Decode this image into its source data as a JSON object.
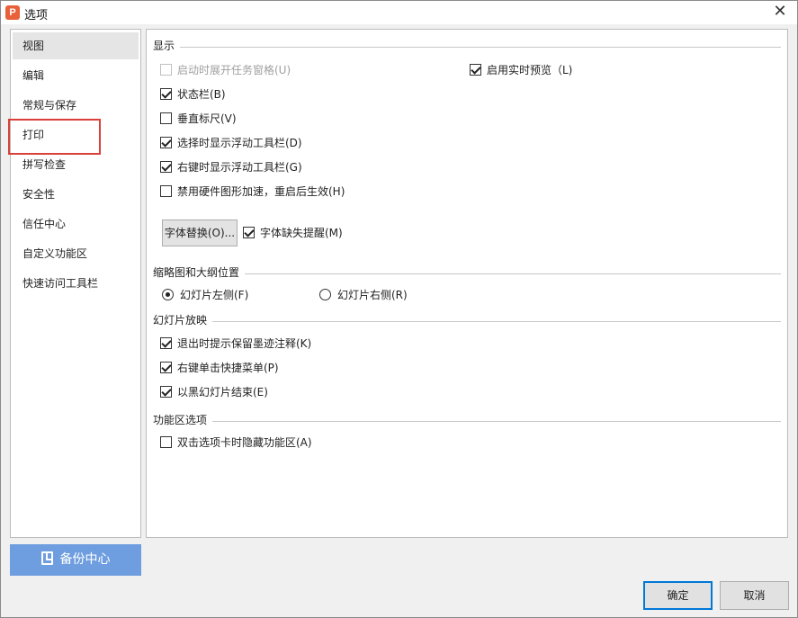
{
  "window": {
    "title": "选项",
    "app_icon_glyph": "P"
  },
  "nav": {
    "items": [
      {
        "label": "视图",
        "active": true
      },
      {
        "label": "编辑"
      },
      {
        "label": "常规与保存"
      },
      {
        "label": "打印"
      },
      {
        "label": "拼写检查"
      },
      {
        "label": "安全性"
      },
      {
        "label": "信任中心"
      },
      {
        "label": "自定义功能区"
      },
      {
        "label": "快速访问工具栏"
      }
    ],
    "backup_label": "备份中心"
  },
  "sections": {
    "display": {
      "title": "显示",
      "show_task_pane": {
        "label": "启动时展开任务窗格(U)",
        "checked": false,
        "disabled": true
      },
      "live_preview": {
        "label": "启用实时预览（L)",
        "checked": true
      },
      "status_bar": {
        "label": "状态栏(B)",
        "checked": true
      },
      "vertical_ruler": {
        "label": "垂直标尺(V)",
        "checked": false
      },
      "float_toolbar_select": {
        "label": "选择时显示浮动工具栏(D)",
        "checked": true
      },
      "float_toolbar_right": {
        "label": "右键时显示浮动工具栏(G)",
        "checked": true
      },
      "disable_hw_accel": {
        "label": "禁用硬件图形加速，重启后生效(H)",
        "checked": false
      },
      "font_replace_button": "字体替换(O)...",
      "missing_font_alert": {
        "label": "字体缺失提醒(M)",
        "checked": true
      }
    },
    "thumbnail": {
      "title": "缩略图和大纲位置",
      "left": {
        "label": "幻灯片左侧(F)",
        "selected": true
      },
      "right": {
        "label": "幻灯片右侧(R)",
        "selected": false
      }
    },
    "slideshow": {
      "title": "幻灯片放映",
      "keep_ink": {
        "label": "退出时提示保留墨迹注释(K)",
        "checked": true
      },
      "right_click_menu": {
        "label": "右键单击快捷菜单(P)",
        "checked": true
      },
      "end_black": {
        "label": "以黑幻灯片结束(E)",
        "checked": true
      }
    },
    "ribbon": {
      "title": "功能区选项",
      "hide_on_dblclick": {
        "label": "双击选项卡时隐藏功能区(A)",
        "checked": false
      }
    }
  },
  "footer": {
    "ok_label": "确定",
    "cancel_label": "取消"
  }
}
